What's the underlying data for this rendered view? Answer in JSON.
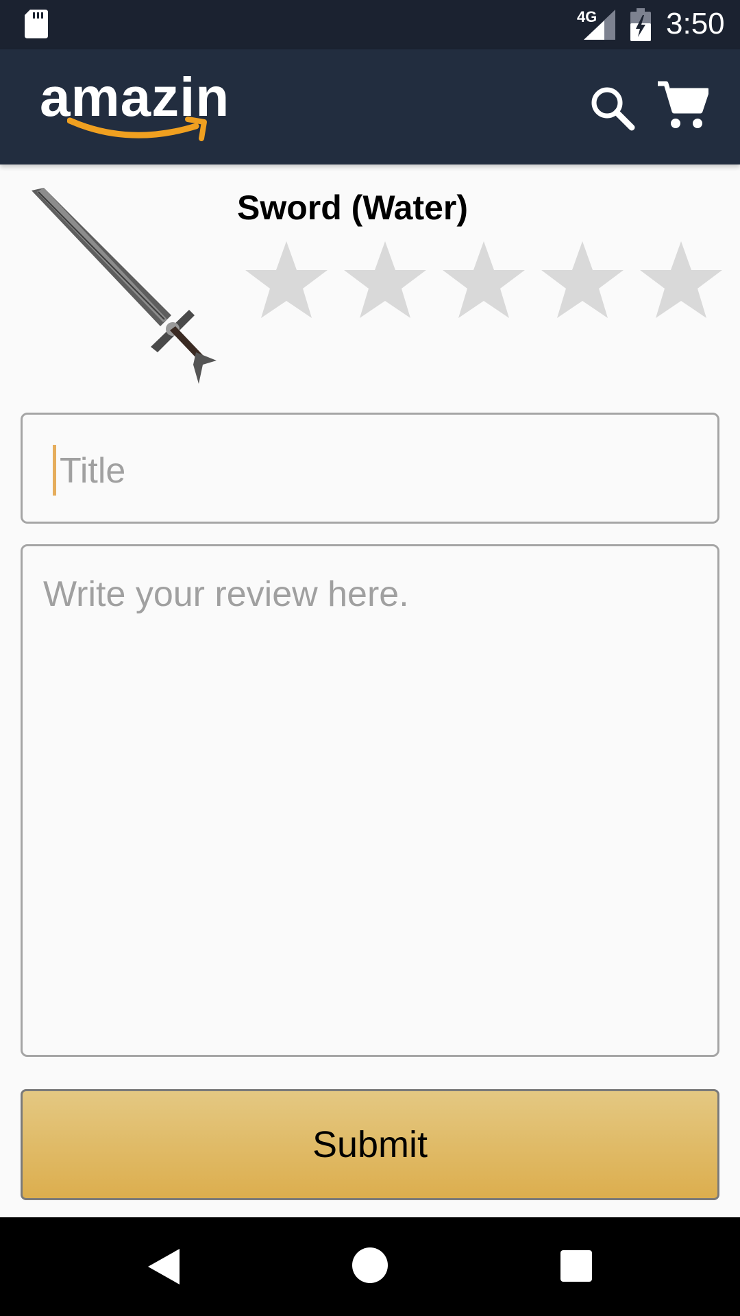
{
  "status_bar": {
    "network_type": "4G",
    "time": "3:50"
  },
  "app_bar": {
    "logo_text": "amazin",
    "logo_accent_color": "#f0a020",
    "search_icon": "search-icon",
    "cart_icon": "cart-icon"
  },
  "product": {
    "name": "Sword (Water)",
    "image_icon": "sword-image",
    "rating": {
      "selected": 0,
      "max": 5,
      "star_color": "#d9d9d9"
    }
  },
  "form": {
    "title_placeholder": "Title",
    "title_value": "",
    "review_placeholder": "Write your review here.",
    "review_value": "",
    "submit_label": "Submit",
    "submit_color": "#dcb560"
  },
  "nav_bar": {
    "back_icon": "back-icon",
    "home_icon": "home-icon",
    "recents_icon": "recents-icon"
  }
}
